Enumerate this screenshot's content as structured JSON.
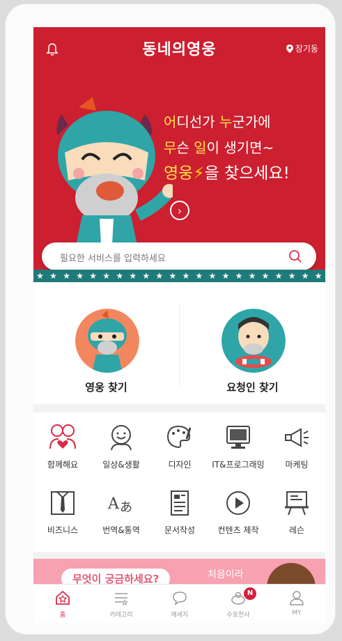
{
  "header": {
    "logo": "동네의영웅",
    "location": "장기동"
  },
  "hero": {
    "line1_highlight": "어",
    "line1_rest": "디선가 ",
    "line1_highlight2": "누",
    "line1_rest2": "군가에",
    "line2_highlight": "무",
    "line2_rest": "슨 ",
    "line2_highlight2": "일",
    "line2_rest2": "이 생기면~",
    "line3_highlight": "영웅",
    "line3_bolt": "⚡",
    "line3_rest": "을 찾으세요!",
    "arrow": "›"
  },
  "search": {
    "placeholder": "필요한 서비스를 입력하세요"
  },
  "find": {
    "hero_label": "영웅 찾기",
    "requester_label": "요청인 찾기"
  },
  "categories": [
    {
      "label": "함께해요",
      "icon": "people-heart-icon"
    },
    {
      "label": "일상&생활",
      "icon": "smile-hand-icon"
    },
    {
      "label": "디자인",
      "icon": "palette-icon"
    },
    {
      "label": "IT&프로그래밍",
      "icon": "monitor-icon"
    },
    {
      "label": "마케팅",
      "icon": "megaphone-icon"
    },
    {
      "label": "비즈니스",
      "icon": "shirt-tie-icon"
    },
    {
      "label": "번역&통역",
      "icon": "translate-icon"
    },
    {
      "label": "문서작성",
      "icon": "document-icon"
    },
    {
      "label": "컨텐츠 제작",
      "icon": "play-icon"
    },
    {
      "label": "레슨",
      "icon": "lesson-board-icon"
    }
  ],
  "banner": {
    "pill": "무엇이 궁금하세요?",
    "side": "처음이라"
  },
  "nav": [
    {
      "label": "홈",
      "active": true
    },
    {
      "label": "카테고리"
    },
    {
      "label": "메세지"
    },
    {
      "label": "수호천사",
      "badge": "N"
    },
    {
      "label": "MY"
    }
  ],
  "colors": {
    "brand_red": "#cc1f2f",
    "accent_pink": "#d92b45",
    "teal": "#1f7a7a"
  }
}
